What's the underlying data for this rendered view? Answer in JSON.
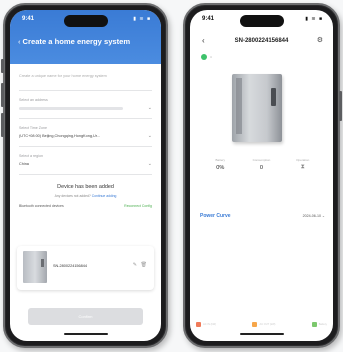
{
  "left_phone": {
    "status": {
      "time": "9:41",
      "icons": "▮ ≋ ■"
    },
    "header": {
      "back_icon": "chevron-left",
      "title": "Create a home energy system"
    },
    "fields": [
      {
        "label": "",
        "value": "Create a unique name for your home energy system"
      },
      {
        "label": "Select an address",
        "value": ""
      },
      {
        "label": "Select Time Zone",
        "value": "(UTC+08:00) Beijing,Chongqing,HongKong,Ur..."
      },
      {
        "label": "Select a region",
        "value": "China"
      }
    ],
    "added_title": "Device has been added",
    "added_sub": {
      "text": "Any devices not added?",
      "link": "Continue adding"
    },
    "bluetooth": {
      "label": "Bluetooth connected devices",
      "link": "Reconnect Config"
    },
    "device": {
      "sn": "SN-2800224156844"
    },
    "confirm_label": "Confirm"
  },
  "right_phone": {
    "status": {
      "time": "9:41",
      "icons": "▮ ≋ ■"
    },
    "header": {
      "back_icon": "chevron-left",
      "sn": "SN-2800224156844",
      "settings_icon": "gear"
    },
    "status_indicator": {
      "color": "#3ec26b",
      "text": "U"
    },
    "stats": [
      {
        "label": "Battery",
        "value": "0%"
      },
      {
        "label": "Consumption",
        "value": "0"
      },
      {
        "label": "Operation",
        "value": "",
        "icon": "hourglass"
      }
    ],
    "power_curve": {
      "title": "Power Curve",
      "date": "2024-06-10"
    },
    "legend": [
      {
        "label": "AC IN (kW)",
        "color": "#f07b5a"
      },
      {
        "label": "AC OUT (kW)",
        "color": "#f6a64a"
      },
      {
        "label": "Battery",
        "color": "#7cc86d"
      }
    ]
  },
  "colors": {
    "accent": "#3a7bd5",
    "online": "#3ec26b"
  }
}
